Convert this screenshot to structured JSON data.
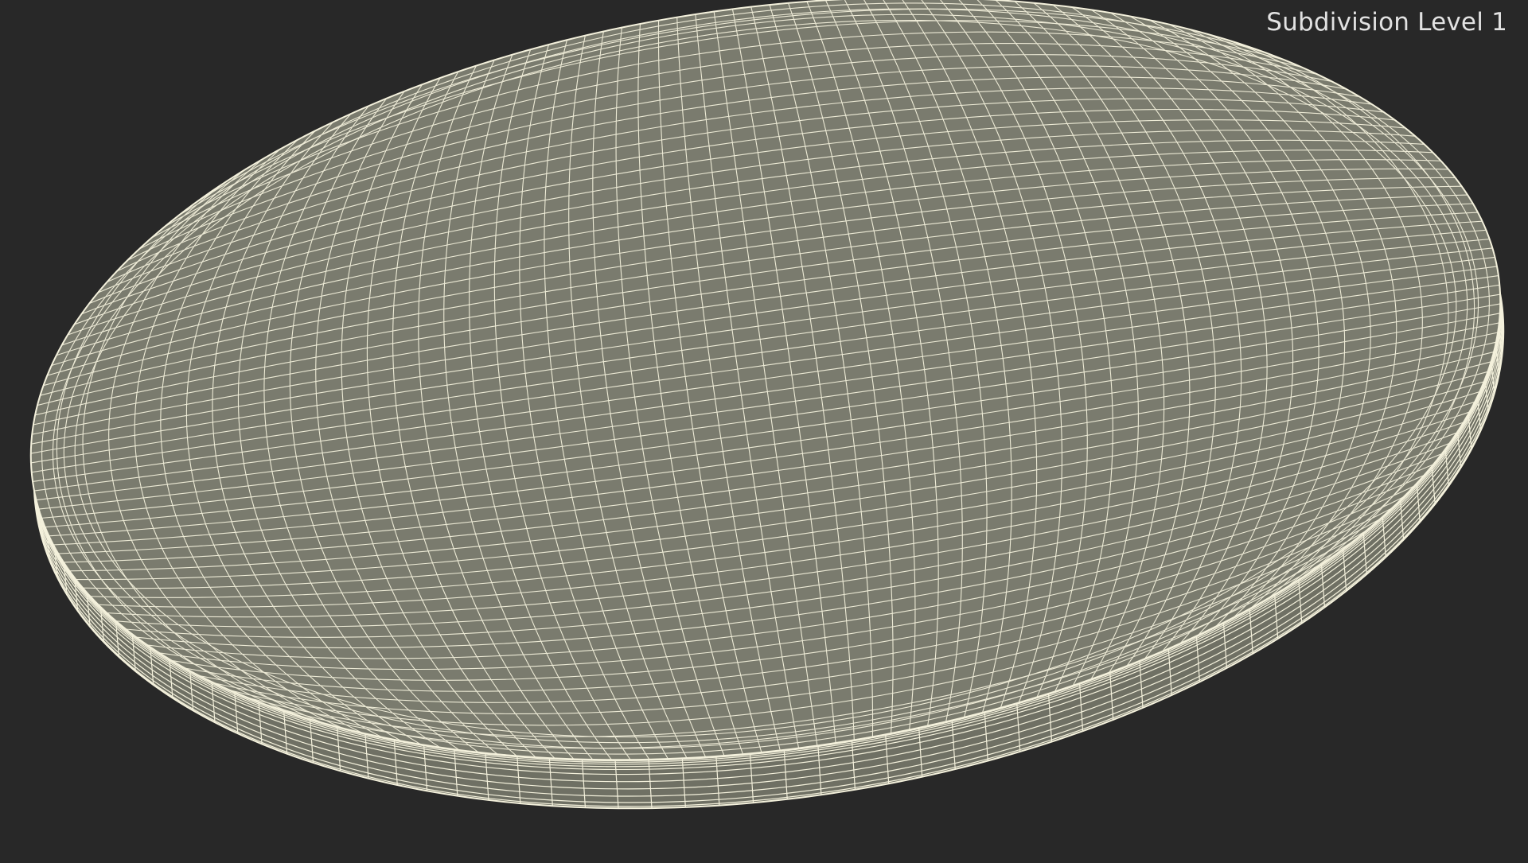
{
  "viewport": {
    "label": "Subdivision Level 1",
    "background_color": "#282828",
    "surface_color": "#7a7b6e",
    "side_color": "#6f7064",
    "wire_color": "#f4f1dc"
  },
  "model": {
    "shape": "elliptical disc / slab",
    "display": "wireframe on shaded"
  }
}
